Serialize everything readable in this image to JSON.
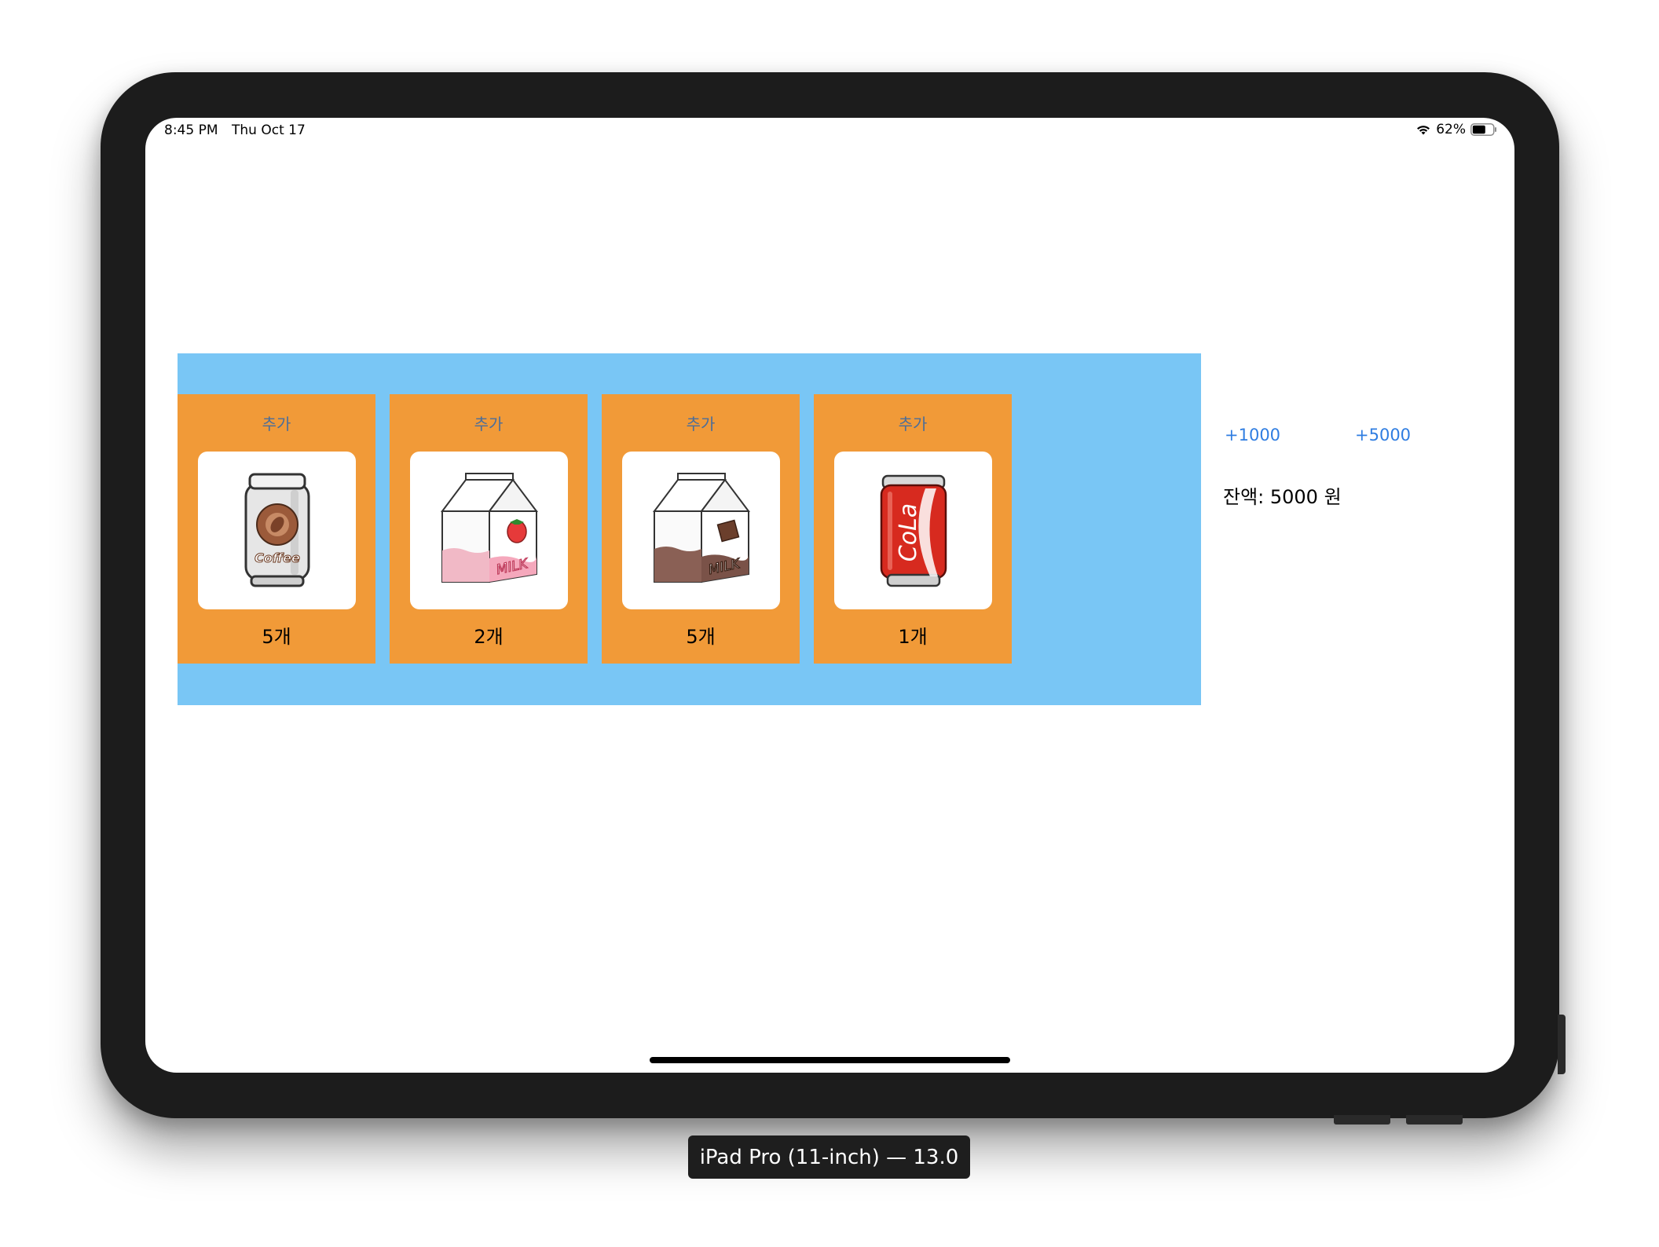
{
  "status_bar": {
    "time": "8:45 PM",
    "date": "Thu Oct 17",
    "battery": "62%"
  },
  "products": [
    {
      "add_label": "추가",
      "count": "5개",
      "image": "coffee-can-icon"
    },
    {
      "add_label": "추가",
      "count": "2개",
      "image": "strawberry-milk-icon"
    },
    {
      "add_label": "추가",
      "count": "5개",
      "image": "chocolate-milk-icon"
    },
    {
      "add_label": "추가",
      "count": "1개",
      "image": "cola-can-icon"
    }
  ],
  "money": {
    "add_1000": "+1000",
    "add_5000": "+5000",
    "balance": "잔액: 5000 원"
  },
  "simulator": {
    "device_label": "iPad Pro (11-inch) — 13.0"
  },
  "colors": {
    "vending_bg": "#79c6f5",
    "card_bg": "#f19a38",
    "accent": "#2f7de1"
  }
}
